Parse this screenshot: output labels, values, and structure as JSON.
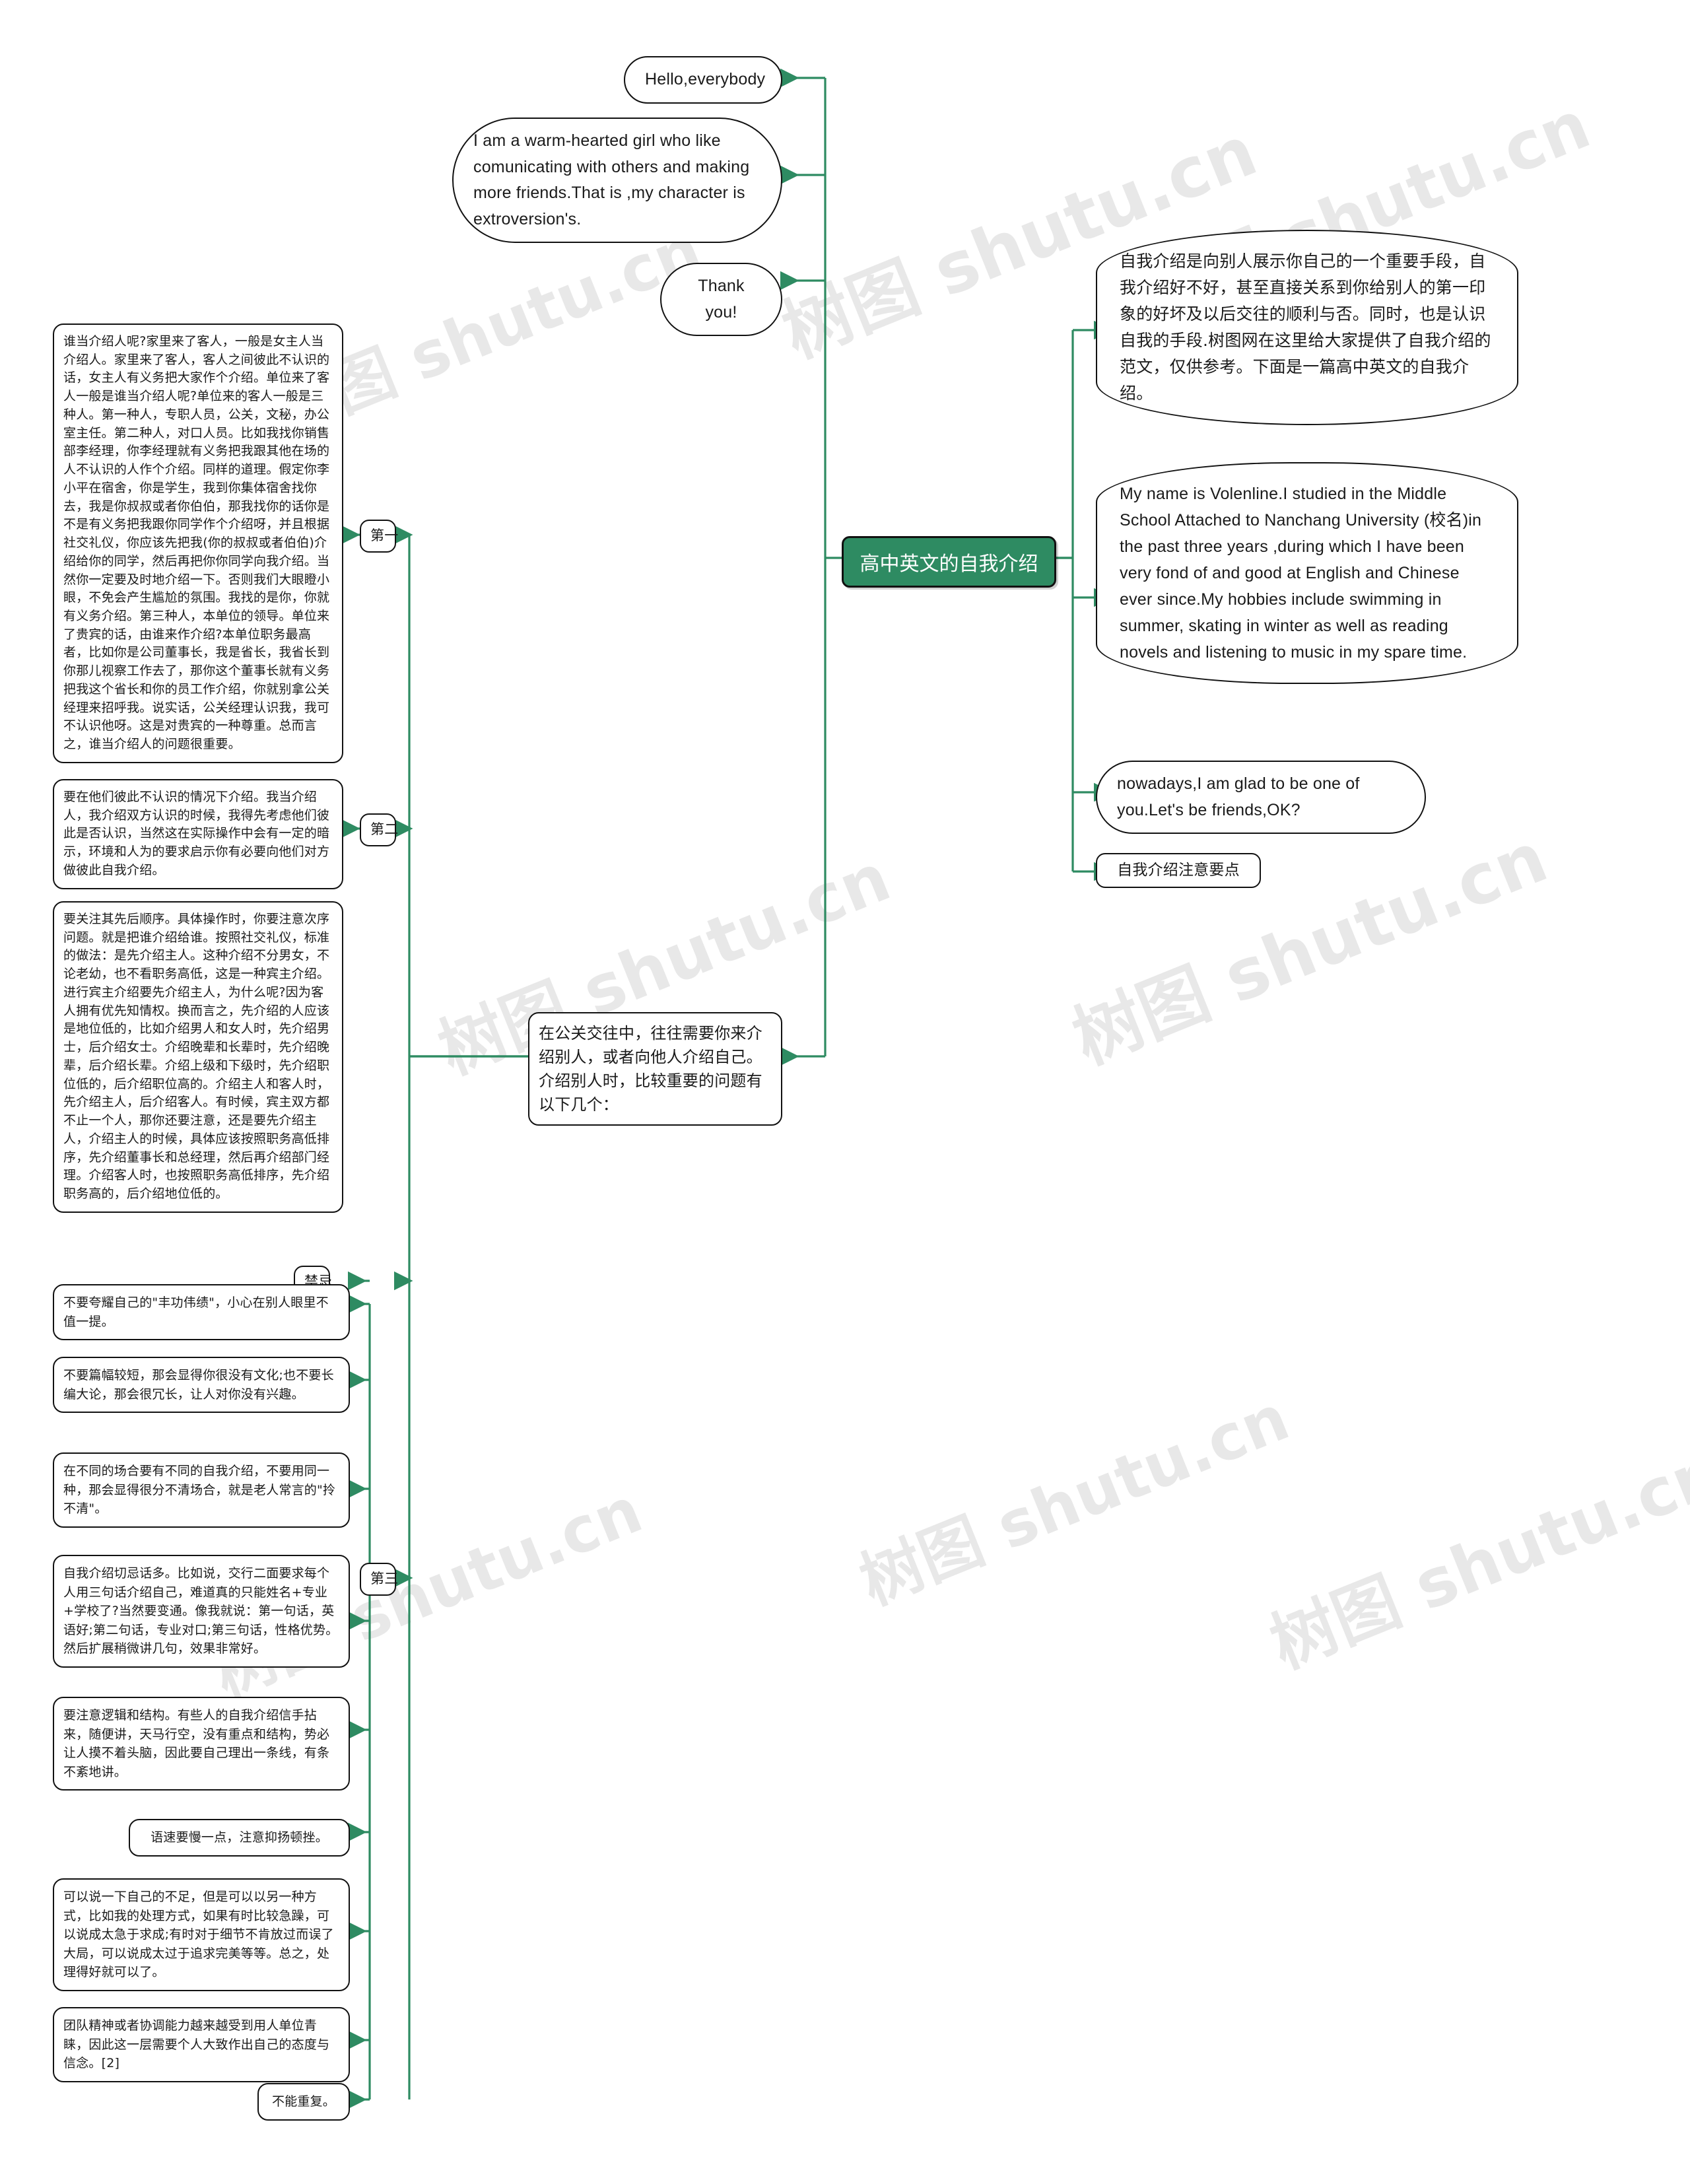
{
  "root": {
    "label": "高中英文的自我介绍",
    "color": "#2e8b62"
  },
  "watermarks": [
    "树图 shutu.cn",
    "树图 shutu.cn",
    "树图 shutu.cn",
    "树图 shutu.cn",
    "树图 shutu.cn",
    "树图 shutu.cn"
  ],
  "nodes": {
    "hello": "Hello,everybody",
    "warm": "I am a warm-hearted girl who like comunicating with others and making more friends.That is ,my character is extroversion's.",
    "thanks": "Thank you!",
    "intro_cn": "自我介绍是向别人展示你自己的一个重要手段，自我介绍好不好，甚至直接关系到你给别人的第一印象的好坏及以后交往的顺利与否。同时，也是认识自我的手段.树图网在这里给大家提供了自我介绍的范文，仅供参考。下面是一篇高中英文的自我介绍。",
    "sample_en": "My name is Volenline.I studied in the Middle School Attached to Nanchang University (校名)in the past three years ,during which I have been very fond of and good at English and Chinese ever since.My hobbies include swimming in summer, skating in winter as well as reading novels and listening to music in my spare time.",
    "nowadays": "nowadays,I am glad to be one of you.Let's be friends,OK?",
    "key_points": "自我介绍注意要点",
    "social_intro": "在公关交往中，往往需要你来介绍别人，或者向他人介绍自己。介绍别人时，比较重要的问题有以下几个：",
    "first_chip": "第一",
    "second_chip": "第二",
    "third_chip": "第三",
    "taboo_chip": "禁忌",
    "first_body": "谁当介绍人呢?家里来了客人，一般是女主人当介绍人。家里来了客人，客人之间彼此不认识的话，女主人有义务把大家作个介绍。单位来了客人一般是谁当介绍人呢?单位来的客人一般是三种人。第一种人，专职人员，公关，文秘，办公室主任。第二种人，对口人员。比如我找你销售部李经理，你李经理就有义务把我跟其他在场的人不认识的人作个介绍。同样的道理。假定你李小平在宿舍，你是学生，我到你集体宿舍找你去，我是你叔叔或者你伯伯，那我找你的话你是不是有义务把我跟你同学作个介绍呀，并且根据社交礼仪，你应该先把我(你的叔叔或者伯伯)介绍给你的同学，然后再把你你同学向我介绍。当然你一定要及时地介绍一下。否则我们大眼瞪小眼，不免会产生尴尬的氛围。我找的是你，你就有义务介绍。第三种人，本单位的领导。单位来了贵宾的话，由谁来作介绍?本单位职务最高者，比如你是公司董事长，我是省长，我省长到你那儿视察工作去了，那你这个董事长就有义务把我这个省长和你的员工作介绍，你就别拿公关经理来招呼我。说实话，公关经理认识我，我可不认识他呀。这是对贵宾的一种尊重。总而言之，谁当介绍人的问题很重要。",
    "second_body": "要在他们彼此不认识的情况下介绍。我当介绍人，我介绍双方认识的时候，我得先考虑他们彼此是否认识，当然这在实际操作中会有一定的暗示，环境和人为的要求启示你有必要向他们对方做彼此自我介绍。",
    "order_body": "要关注其先后顺序。具体操作时，你要注意次序问题。就是把谁介绍给谁。按照社交礼仪，标准的做法：是先介绍主人。这种介绍不分男女，不论老幼，也不看职务高低，这是一种宾主介绍。进行宾主介绍要先介绍主人，为什么呢?因为客人拥有优先知情权。换而言之，先介绍的人应该是地位低的，比如介绍男人和女人时，先介绍男士，后介绍女士。介绍晚辈和长辈时，先介绍晚辈，后介绍长辈。介绍上级和下级时，先介绍职位低的，后介绍职位高的。介绍主人和客人时，先介绍主人，后介绍客人。有时候，宾主双方都不止一个人，那你还要注意，还是要先介绍主人，介绍主人的时候，具体应该按照职务高低排序，先介绍董事长和总经理，然后再介绍部门经理。介绍客人时，也按照职务高低排序，先介绍职务高的，后介绍地位低的。",
    "taboo_1": "不要夸耀自己的\"丰功伟绩\"，小心在别人眼里不值一提。",
    "taboo_2": "不要篇幅较短，那会显得你很没有文化;也不要长编大论，那会很冗长，让人对你没有兴趣。",
    "taboo_3": "在不同的场合要有不同的自我介绍，不要用同一种，那会显得很分不清场合，就是老人常言的\"拎不清\"。",
    "taboo_4": "自我介绍切忌话多。比如说，交行二面要求每个人用三句话介绍自己，难道真的只能姓名+专业+学校了?当然要变通。像我就说：第一句话，英语好;第二句话，专业对口;第三句话，性格优势。然后扩展稍微讲几句，效果非常好。",
    "taboo_5": "要注意逻辑和结构。有些人的自我介绍信手拈来，随便讲，天马行空，没有重点和结构，势必让人摸不着头脑，因此要自己理出一条线，有条不紊地讲。",
    "taboo_6": "语速要慢一点，注意抑扬顿挫。",
    "taboo_7": "可以说一下自己的不足，但是可以以另一种方式，比如我的处理方式，如果有时比较急躁，可以说成太急于求成;有时对于细节不肯放过而误了大局，可以说成太过于追求完美等等。总之，处理得好就可以了。",
    "taboo_8": "团队精神或者协调能力越来越受到用人单位青睐，因此这一层需要个人大致作出自己的态度与信念。[2]",
    "taboo_9": "不能重复。"
  }
}
